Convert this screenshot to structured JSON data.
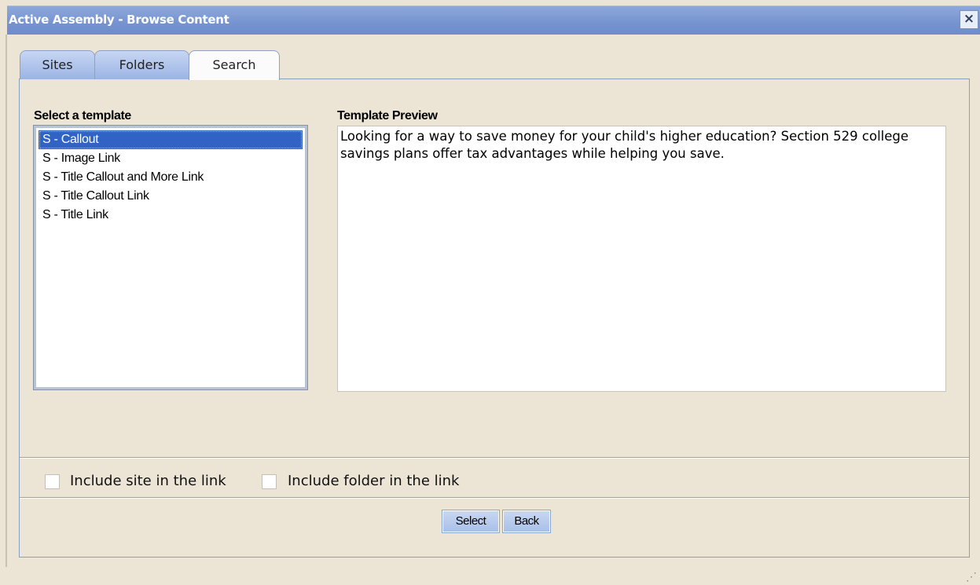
{
  "window": {
    "title": "Active Assembly - Browse Content",
    "close_glyph": "×"
  },
  "tabs": [
    {
      "label": "Sites"
    },
    {
      "label": "Folders"
    },
    {
      "label": "Search"
    }
  ],
  "active_tab": "Search",
  "template_section": {
    "label": "Select a template",
    "items": [
      {
        "label": "S - Callout",
        "selected": true
      },
      {
        "label": "S - Image Link"
      },
      {
        "label": "S - Title Callout and More Link"
      },
      {
        "label": "S - Title Callout Link"
      },
      {
        "label": "S - Title Link"
      }
    ]
  },
  "preview": {
    "label": "Template Preview",
    "text": "Looking for a way to save money for your child's higher education? Section 529 college savings plans offer tax advantages while helping you save."
  },
  "options": {
    "include_site": {
      "label": "Include site in the link",
      "checked": false
    },
    "include_folder": {
      "label": "Include folder in the link",
      "checked": false
    }
  },
  "buttons": {
    "select": "Select",
    "back": "Back"
  },
  "colors": {
    "titlebar": "#7593cf",
    "selection": "#3163c5",
    "background": "#ece5d6"
  },
  "icons": {
    "close": "close-icon",
    "resize": "resize-grip-icon"
  }
}
